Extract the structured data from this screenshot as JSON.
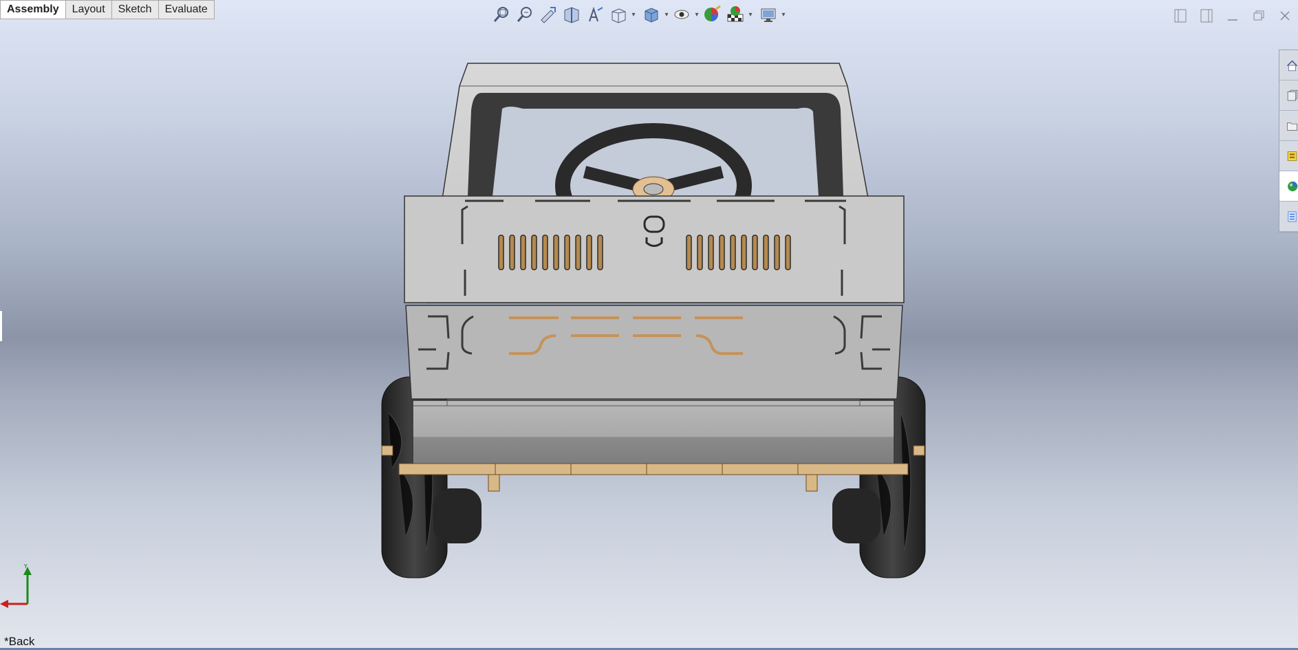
{
  "tabs": [
    {
      "label": "Assembly",
      "active": true
    },
    {
      "label": "Layout",
      "active": false
    },
    {
      "label": "Sketch",
      "active": false
    },
    {
      "label": "Evaluate",
      "active": false
    }
  ],
  "toolbar": {
    "icons": [
      "zoom-to-fit-icon",
      "zoom-to-area-icon",
      "previous-view-icon",
      "section-view-icon",
      "dynamic-annotation-views-icon",
      "view-orientation-icon",
      "display-style-icon",
      "hide-show-items-icon",
      "edit-appearance-icon",
      "apply-scene-icon",
      "view-settings-icon"
    ]
  },
  "view": {
    "name": "*Back",
    "triad_y_label": "Y",
    "model": "ride-on-car-assembly-rear-view"
  },
  "colors": {
    "body_panel": "#c9c9c9",
    "wood": "#d9b888",
    "tire": "#2f2f2f",
    "accent": "#6e7fa6"
  }
}
